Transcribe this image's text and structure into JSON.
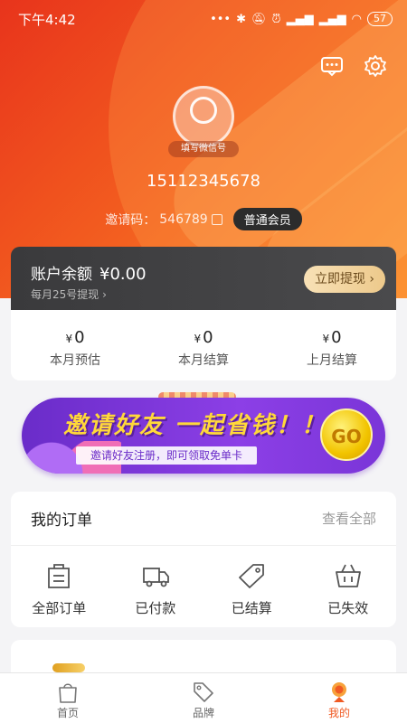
{
  "status_bar": {
    "time": "下午4:42",
    "battery": "57"
  },
  "profile": {
    "avatar_tag": "填写微信号",
    "phone": "15112345678",
    "invite_label": "邀请码：",
    "invite_code": "546789",
    "member_level": "普通会员"
  },
  "balance": {
    "title": "账户余额",
    "amount": "¥0.00",
    "note": "每月25号提现",
    "withdraw_label": "立即提现"
  },
  "stats": [
    {
      "currency": "¥",
      "value": "0",
      "label": "本月预估"
    },
    {
      "currency": "¥",
      "value": "0",
      "label": "本月结算"
    },
    {
      "currency": "¥",
      "value": "0",
      "label": "上月结算"
    }
  ],
  "banner": {
    "title": "邀请好友 一起省钱！！",
    "subtitle": "邀请好友注册，即可领取免单卡",
    "go": "GO"
  },
  "orders": {
    "title": "我的订单",
    "view_all": "查看全部",
    "items": [
      {
        "label": "全部订单",
        "icon": "bag-icon"
      },
      {
        "label": "已付款",
        "icon": "truck-icon"
      },
      {
        "label": "已结算",
        "icon": "tag-icon"
      },
      {
        "label": "已失效",
        "icon": "basket-icon"
      }
    ]
  },
  "tabbar": [
    {
      "label": "首页",
      "icon": "shopping-bag-icon"
    },
    {
      "label": "品牌",
      "icon": "price-tag-icon"
    },
    {
      "label": "我的",
      "icon": "profile-icon"
    }
  ],
  "colors": {
    "accent": "#f05a23",
    "hero_start": "#e8341c",
    "hero_end": "#fb8a2a",
    "banner": "#7a35d8"
  }
}
